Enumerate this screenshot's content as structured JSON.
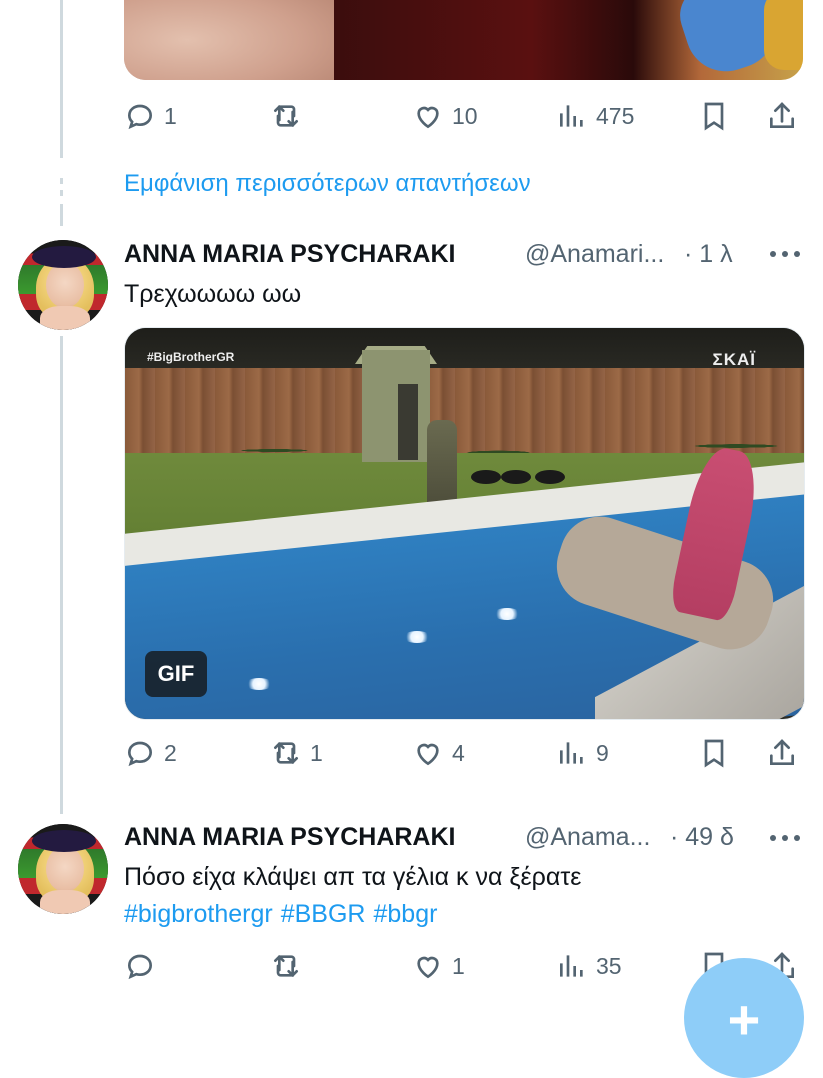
{
  "tweet1": {
    "actions": {
      "replies": "1",
      "retweets": "",
      "likes": "10",
      "views": "475"
    }
  },
  "show_more": "Εμφάνιση περισσότερων απαντήσεων",
  "tweet2": {
    "name": "ANNA MARIA PSYCHARAKI",
    "handle": "@Anamari...",
    "time": "· 1 λ",
    "text": "Τρεχωωωω ωω",
    "media": {
      "badge": "GIF",
      "logo_left": "#BigBrotherGR",
      "logo_right": "ΣΚΑΪ"
    },
    "actions": {
      "replies": "2",
      "retweets": "1",
      "likes": "4",
      "views": "9"
    }
  },
  "tweet3": {
    "name": "ANNA MARIA PSYCHARAKI",
    "handle": "@Anama...",
    "time": "· 49 δ",
    "text": "Πόσο είχα κλάψει απ τα γέλια κ να ξέρατε",
    "hashtags": [
      "#bigbrothergr",
      "#BBGR",
      "#bbgr"
    ],
    "actions": {
      "replies": "",
      "retweets": "",
      "likes": "1",
      "views": "35"
    }
  },
  "fab": {
    "label": "+"
  },
  "colors": {
    "link": "#1d9bf0",
    "muted": "#536471",
    "fab": "#8ecdf8"
  },
  "icons": [
    "reply-icon",
    "retweet-icon",
    "like-icon",
    "views-icon",
    "bookmark-icon",
    "share-icon",
    "more-icon",
    "compose-icon"
  ]
}
